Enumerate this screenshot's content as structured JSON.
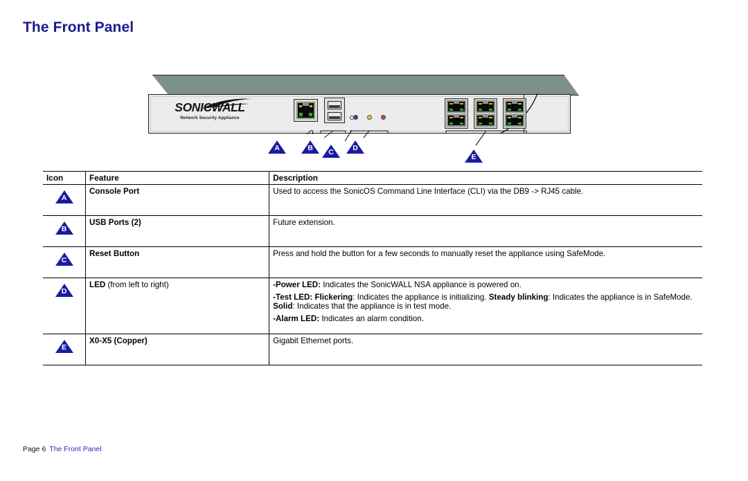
{
  "page": {
    "title": "The Front Panel",
    "footer_page": "Page 6",
    "footer_section": "The Front Panel"
  },
  "device": {
    "brand": "SONICWALL",
    "tagline": "Network Security Appliance",
    "callouts": [
      {
        "id": "A",
        "label": "A"
      },
      {
        "id": "B",
        "label": "B"
      },
      {
        "id": "C",
        "label": "C"
      },
      {
        "id": "D",
        "label": "D"
      },
      {
        "id": "E",
        "label": "E"
      }
    ],
    "leds": [
      {
        "name": "power-led",
        "color": "#3a3ab0"
      },
      {
        "name": "test-led",
        "color": "#d6d43a"
      },
      {
        "name": "alarm-led",
        "color": "#d6406a"
      }
    ],
    "ethernet_ports": 6,
    "usb_ports": 2
  },
  "table": {
    "headers": {
      "icon": "Icon",
      "feature": "Feature",
      "description": "Description"
    },
    "rows": [
      {
        "icon": "A",
        "feature_bold": "Console Port",
        "feature_plain": "",
        "description_lines": [
          "Used to access the SonicOS Command Line Interface (CLI) via the DB9 -> RJ45 cable."
        ]
      },
      {
        "icon": "B",
        "feature_bold": "USB Ports (2)",
        "feature_plain": "",
        "description_lines": [
          "Future extension."
        ]
      },
      {
        "icon": "C",
        "feature_bold": "Reset Button",
        "feature_plain": "",
        "description_lines": [
          "Press and hold the button for a few seconds to manually reset the appliance using SafeMode."
        ]
      },
      {
        "icon": "D",
        "feature_bold": "LED",
        "feature_plain": " (from left to right)",
        "description_lines": [
          "-Power LED: Indicates the SonicWALL NSA appliance is powered on.",
          "-Test LED: Flickering: Indicates the appliance is initializing. Steady blinking: Indicates the appliance is in SafeMode. Solid: Indicates that the appliance is in test mode.",
          "-Alarm LED: Indicates an alarm condition."
        ]
      },
      {
        "icon": "E",
        "feature_bold": "X0-X5 (Copper)",
        "feature_plain": "",
        "description_lines": [
          "Gigabit Ethernet ports."
        ]
      }
    ]
  },
  "colors": {
    "title_blue": "#1b1b8f",
    "callout_blue": "#1a1aa0",
    "chassis_top": "#7e908c",
    "chassis_face": "#ebeceb",
    "link_blue": "#2a2ab5"
  }
}
